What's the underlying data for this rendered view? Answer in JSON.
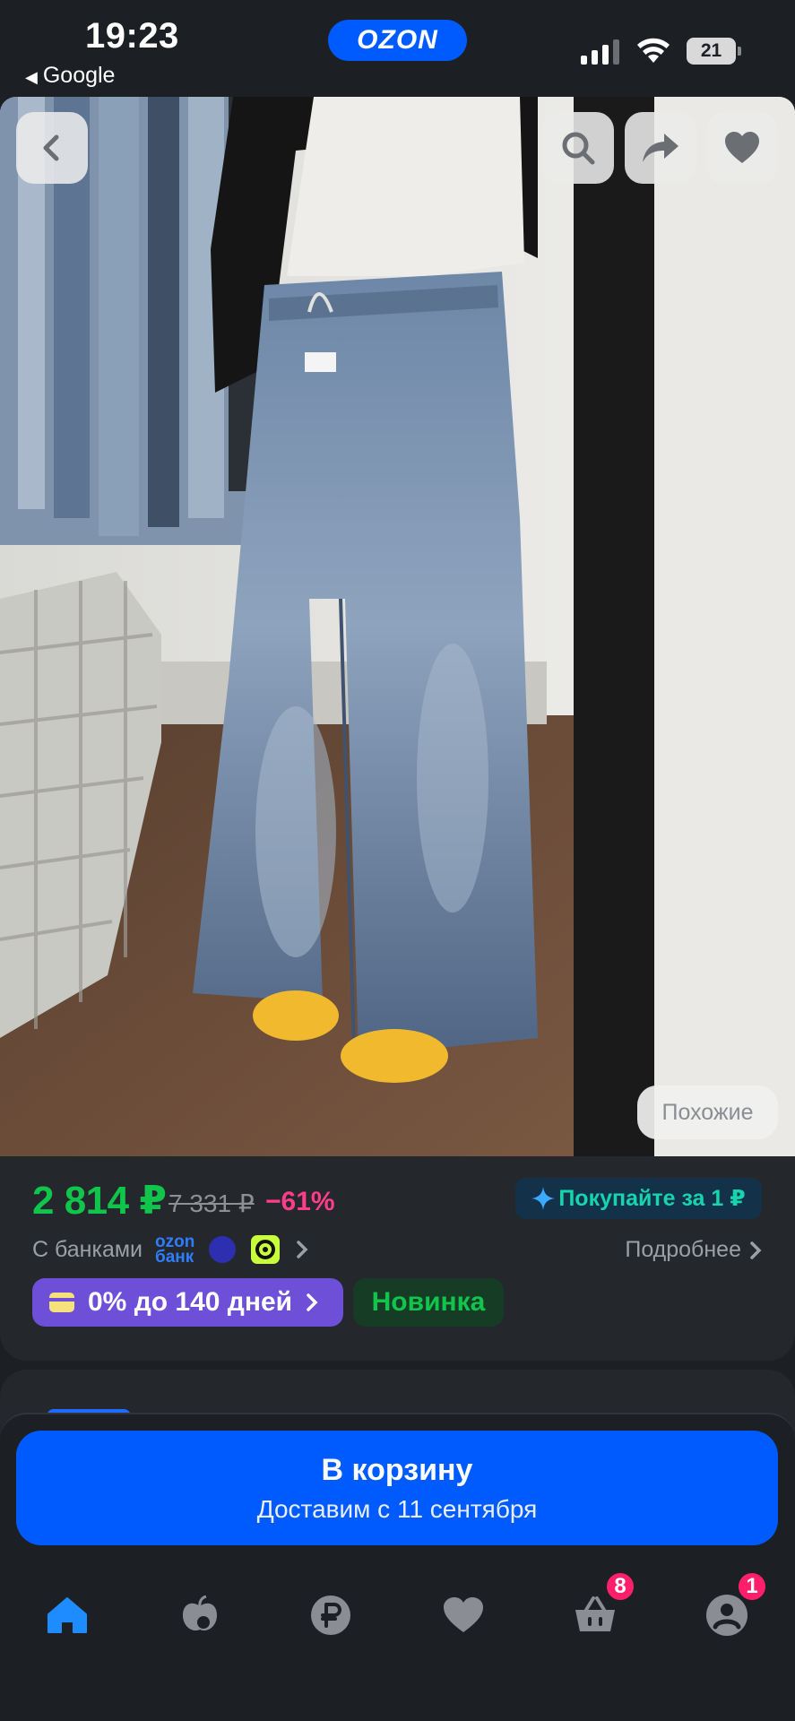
{
  "status_bar": {
    "time": "19:23",
    "back_app": "Google",
    "app_logo": "OZON",
    "battery": "21"
  },
  "product": {
    "similar_button": "Похожие",
    "price": "2 814 ₽",
    "old_price": "7 331 ₽",
    "discount": "−61%",
    "promo": "Покупайте за 1 ₽",
    "banks_label": "С банками",
    "ozon_bank_logo_line1": "ozon",
    "ozon_bank_logo_line2": "банк",
    "details_link": "Подробнее",
    "installment": "0% до 140 дней",
    "new_badge": "Новинка"
  },
  "cart": {
    "title": "В корзину",
    "subtitle": "Доставим с 11 сентября"
  },
  "tabbar": {
    "items": [
      {
        "icon": "home-icon",
        "active": true
      },
      {
        "icon": "fresh-icon"
      },
      {
        "icon": "ruble-icon"
      },
      {
        "icon": "favorites-icon"
      },
      {
        "icon": "cart-icon",
        "badge": "8"
      },
      {
        "icon": "profile-icon",
        "badge": "1"
      }
    ]
  },
  "colors": {
    "accent": "#005bff",
    "price_green": "#10c44c",
    "discount_pink": "#ff3d8b",
    "background": "#1c1f24"
  }
}
